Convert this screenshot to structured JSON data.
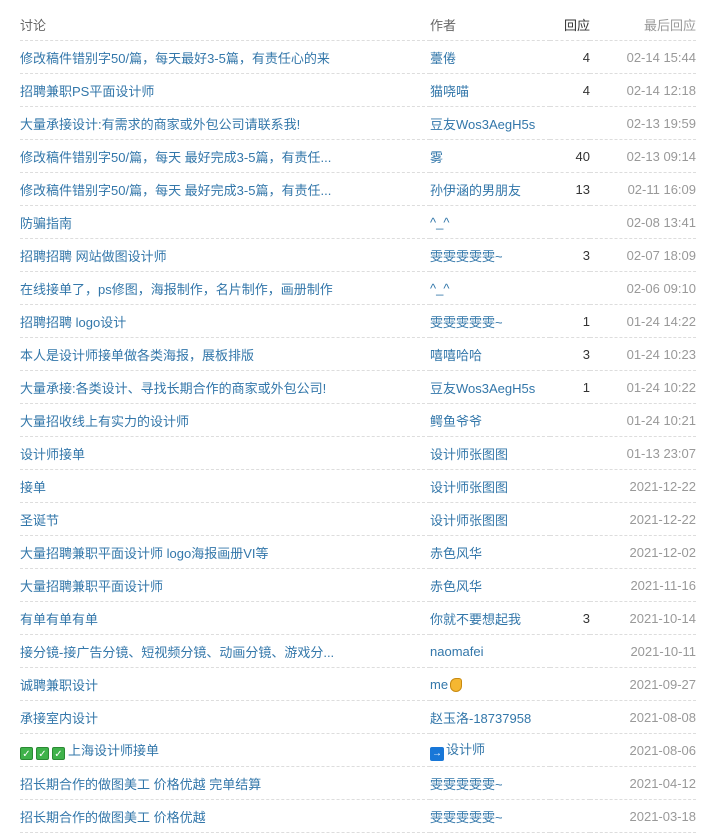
{
  "header": {
    "title": "讨论",
    "author": "作者",
    "replies": "回应",
    "last_reply": "最后回应"
  },
  "colors": {
    "link": "#3377aa",
    "date": "#999999"
  },
  "rows": [
    {
      "title": "修改稿件错别字50/篇，每天最好3-5篇，有责任心的来",
      "author": "薹倦",
      "replies": "4",
      "date": "02-14 15:44"
    },
    {
      "title": "招聘兼职PS平面设计师",
      "author": "猫哓喵",
      "replies": "4",
      "date": "02-14 12:18"
    },
    {
      "title": "大量承接设计:有需求的商家或外包公司请联系我!",
      "author": "豆友Wos3AegH5s",
      "replies": "",
      "date": "02-13 19:59"
    },
    {
      "title": "修改稿件错别字50/篇，每天 最好完成3-5篇，有责任...",
      "author": "雾",
      "replies": "40",
      "date": "02-13 09:14"
    },
    {
      "title": "修改稿件错别字50/篇，每天 最好完成3-5篇，有责任...",
      "author": "孙伊涵的男朋友",
      "replies": "13",
      "date": "02-11 16:09"
    },
    {
      "title": "防骗指南",
      "author": "^_^",
      "replies": "",
      "date": "02-08 13:41"
    },
    {
      "title": "招聘招聘 网站做图设计师",
      "author": "雯雯雯雯雯~",
      "replies": "3",
      "date": "02-07 18:09"
    },
    {
      "title": "在线接单了，ps修图，海报制作，名片制作，画册制作",
      "author": "^_^",
      "replies": "",
      "date": "02-06 09:10"
    },
    {
      "title": "招聘招聘 logo设计",
      "author": "雯雯雯雯雯~",
      "replies": "1",
      "date": "01-24 14:22"
    },
    {
      "title": "本人是设计师接单做各类海报，展板排版",
      "author": "嘻嘻哈哈",
      "replies": "3",
      "date": "01-24 10:23"
    },
    {
      "title": "大量承接:各类设计、寻找长期合作的商家或外包公司!",
      "author": "豆友Wos3AegH5s",
      "replies": "1",
      "date": "01-24 10:22"
    },
    {
      "title": "大量招收线上有实力的设计师",
      "author": "鳄鱼爷爷",
      "replies": "",
      "date": "01-24 10:21"
    },
    {
      "title": "设计师接单",
      "author": "设计师张图图",
      "replies": "",
      "date": "01-13 23:07"
    },
    {
      "title": "接单",
      "author": "设计师张图图",
      "replies": "",
      "date": "2021-12-22"
    },
    {
      "title": "圣诞节",
      "author": "设计师张图图",
      "replies": "",
      "date": "2021-12-22"
    },
    {
      "title": "大量招聘兼职平面设计师 logo海报画册VI等",
      "author": "赤色风华",
      "replies": "",
      "date": "2021-12-02"
    },
    {
      "title": "大量招聘兼职平面设计师",
      "author": "赤色风华",
      "replies": "",
      "date": "2021-11-16"
    },
    {
      "title": "有单有单有单",
      "author": "你就不要想起我",
      "replies": "3",
      "date": "2021-10-14"
    },
    {
      "title": "接分镜-接广告分镜、短视频分镜、动画分镜、游戏分...",
      "author": "naomafei",
      "replies": "",
      "date": "2021-10-11"
    },
    {
      "title": "诚聘兼职设计",
      "author": "me",
      "author_icon": "flexed-biceps",
      "replies": "",
      "date": "2021-09-27"
    },
    {
      "title": "承接室内设计",
      "author": "赵玉洛-18737958",
      "replies": "",
      "date": "2021-08-08"
    },
    {
      "title": "上海设计师接单",
      "title_icons": "check-mark-box x3",
      "author": "设计师",
      "author_icon": "right-arrow",
      "replies": "",
      "date": "2021-08-06"
    },
    {
      "title": "招长期合作的做图美工 价格优越 完单结算",
      "author": "雯雯雯雯雯~",
      "replies": "",
      "date": "2021-04-12"
    },
    {
      "title": "招长期合作的做图美工 价格优越",
      "author": "雯雯雯雯雯~",
      "replies": "",
      "date": "2021-03-18"
    }
  ]
}
